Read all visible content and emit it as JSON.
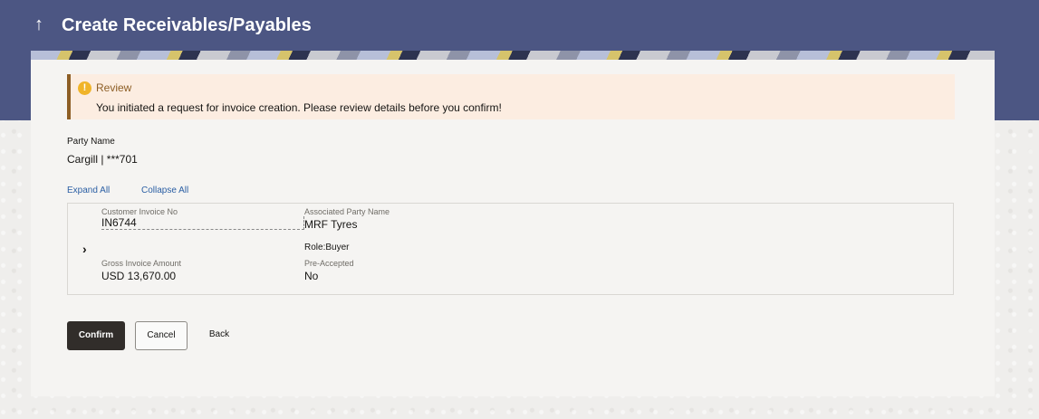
{
  "header": {
    "title": "Create Receivables/Payables",
    "back_icon": "arrow-up-icon"
  },
  "review": {
    "title": "Review",
    "message": "You initiated a request for invoice creation. Please review details before you confirm!",
    "icon": "info-icon",
    "icon_glyph": "!"
  },
  "party": {
    "label": "Party Name",
    "value": "Cargill | ***701"
  },
  "links": {
    "expand_all": "Expand All",
    "collapse_all": "Collapse All"
  },
  "invoice": {
    "customer_invoice_no_label": "Customer Invoice No",
    "customer_invoice_no": "IN6744",
    "associated_party_name_label": "Associated Party Name",
    "associated_party_name": "MRF Tyres",
    "role": "Role:Buyer",
    "gross_invoice_amount_label": "Gross Invoice Amount",
    "gross_invoice_amount": "USD 13,670.00",
    "pre_accepted_label": "Pre-Accepted",
    "pre_accepted": "No"
  },
  "actions": {
    "confirm": "Confirm",
    "cancel": "Cancel",
    "back": "Back"
  },
  "colors": {
    "header_bg": "#4c5683",
    "review_bg": "#fcede1",
    "review_accent": "#8d5e25",
    "link": "#2b5fa4",
    "primary_button": "#312d2a"
  }
}
